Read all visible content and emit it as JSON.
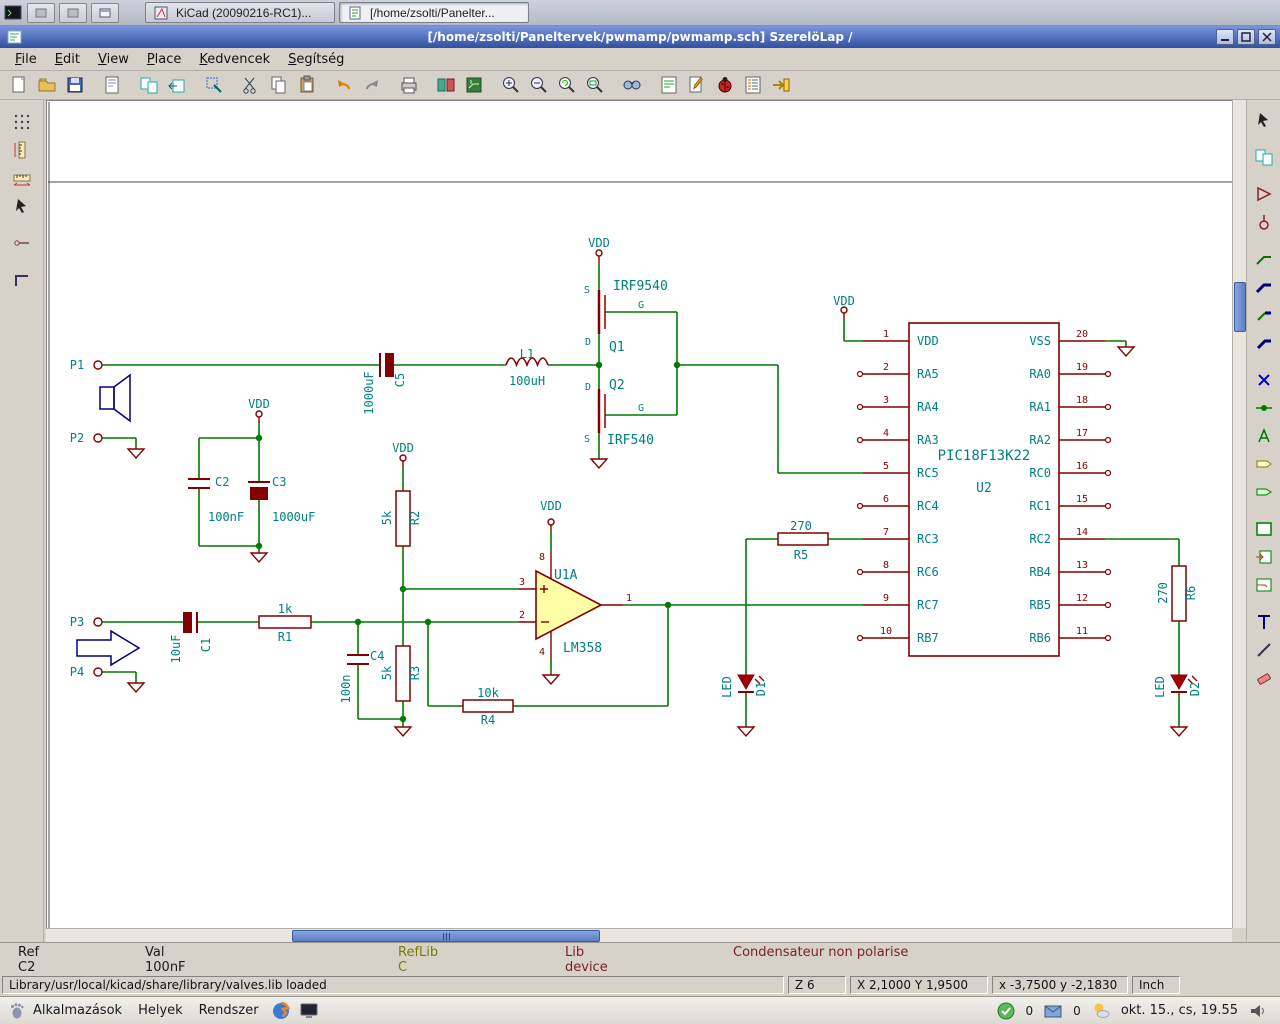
{
  "desktop_top": {
    "tasks": [
      {
        "label": "KiCad (20090216-RC1)..."
      },
      {
        "label": "[/home/zsolti/Panelter..."
      }
    ]
  },
  "window": {
    "title": "[/home/zsolti/Paneltervek/pwmamp/pwmamp.sch]  SzerelöLap /"
  },
  "menu": {
    "items": [
      "File",
      "Edit",
      "View",
      "Place",
      "Kedvencek",
      "Segítség"
    ]
  },
  "schematic": {
    "power": {
      "vdd": "VDD"
    },
    "pins": {
      "s": "S",
      "g": "G",
      "d": "D"
    },
    "p1": "P1",
    "p2": "P2",
    "p3": "P3",
    "p4": "P4",
    "q1": {
      "ref": "Q1",
      "val": "IRF9540"
    },
    "q2": {
      "ref": "Q2",
      "val": "IRF540"
    },
    "l1": {
      "ref": "L1",
      "val": "100uH"
    },
    "c1": {
      "ref": "C1",
      "val": "10uF"
    },
    "c2": {
      "ref": "C2",
      "val": "100nF"
    },
    "c3": {
      "ref": "C3",
      "val": "1000uF"
    },
    "c4": {
      "ref": "C4",
      "val": "100n"
    },
    "c5": {
      "ref": "C5",
      "val": "1000uF"
    },
    "r1": {
      "ref": "R1",
      "val": "1k"
    },
    "r2": {
      "ref": "R2",
      "val": "5k"
    },
    "r3": {
      "ref": "R3",
      "val": "5k"
    },
    "r4": {
      "ref": "R4",
      "val": "10k"
    },
    "r5": {
      "ref": "R5",
      "val": "270"
    },
    "r6": {
      "ref": "R6",
      "val": "270"
    },
    "d1": {
      "ref": "D1",
      "val": "LED"
    },
    "d2": {
      "ref": "D2",
      "val": "LED"
    },
    "u1": {
      "ref": "U1A",
      "val": "LM358",
      "pin1": "1",
      "pin2": "2",
      "pin3": "3",
      "pin4": "4",
      "pin8": "8"
    },
    "u2": {
      "ref": "U2",
      "val": "PIC18F13K22",
      "left_pins": [
        {
          "num": "1",
          "name": "VDD"
        },
        {
          "num": "2",
          "name": "RA5"
        },
        {
          "num": "3",
          "name": "RA4"
        },
        {
          "num": "4",
          "name": "RA3"
        },
        {
          "num": "5",
          "name": "RC5"
        },
        {
          "num": "6",
          "name": "RC4"
        },
        {
          "num": "7",
          "name": "RC3"
        },
        {
          "num": "8",
          "name": "RC6"
        },
        {
          "num": "9",
          "name": "RC7"
        },
        {
          "num": "10",
          "name": "RB7"
        }
      ],
      "right_pins": [
        {
          "num": "20",
          "name": "VSS"
        },
        {
          "num": "19",
          "name": "RA0"
        },
        {
          "num": "18",
          "name": "RA1"
        },
        {
          "num": "17",
          "name": "RA2"
        },
        {
          "num": "16",
          "name": "RC0"
        },
        {
          "num": "15",
          "name": "RC1"
        },
        {
          "num": "14",
          "name": "RC2"
        },
        {
          "num": "13",
          "name": "RB4"
        },
        {
          "num": "12",
          "name": "RB5"
        },
        {
          "num": "11",
          "name": "RB6"
        }
      ]
    }
  },
  "status": {
    "ref_label": "Ref",
    "ref_value": "C2",
    "val_label": "Val",
    "val_value": "100nF",
    "reflib_label": "RefLib",
    "reflib_value": "C",
    "lib_label": "Lib",
    "lib_value": "device",
    "description": "Condensateur non polarise",
    "message": "Library/usr/local/kicad/share/library/valves.lib loaded",
    "zoom": "Z 6",
    "abs_xy": "X 2,1000  Y 1,9500",
    "rel_xy": "x -3,7500  y -2,1830",
    "units": "Inch"
  },
  "panel": {
    "menus": [
      "Alkalmazások",
      "Helyek",
      "Rendszer"
    ],
    "badge1": "0",
    "badge2": "0",
    "clock": "okt. 15., cs, 19.55"
  }
}
